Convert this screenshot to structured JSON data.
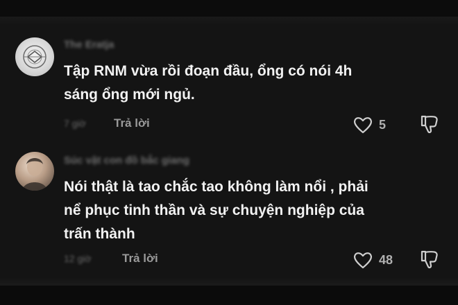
{
  "colors": {
    "background": "#141414",
    "text_primary": "#f2f2f2",
    "text_secondary": "#9a9a9a",
    "icon": "#cfcfcf"
  },
  "comments": [
    {
      "username": "The Eratja",
      "text": "Tập RNM vừa rồi đoạn đầu, ổng có nói 4h\nsáng ổng mới ngủ.",
      "timestamp": "7 giờ",
      "reply_label": "Trả lời",
      "like_count": "5",
      "like_icon": "heart-outline-icon",
      "dislike_icon": "thumbs-down-icon"
    },
    {
      "username": "Súc vật con đồ bắc giang",
      "text": "Nói thật là tao chắc tao không làm nổi , phải\nnể phục tinh thần và sự chuyện nghiệp của\ntrấn thành",
      "timestamp": "12 giờ",
      "reply_label": "Trả lời",
      "like_count": "48",
      "like_icon": "heart-outline-icon",
      "dislike_icon": "thumbs-down-icon"
    }
  ]
}
